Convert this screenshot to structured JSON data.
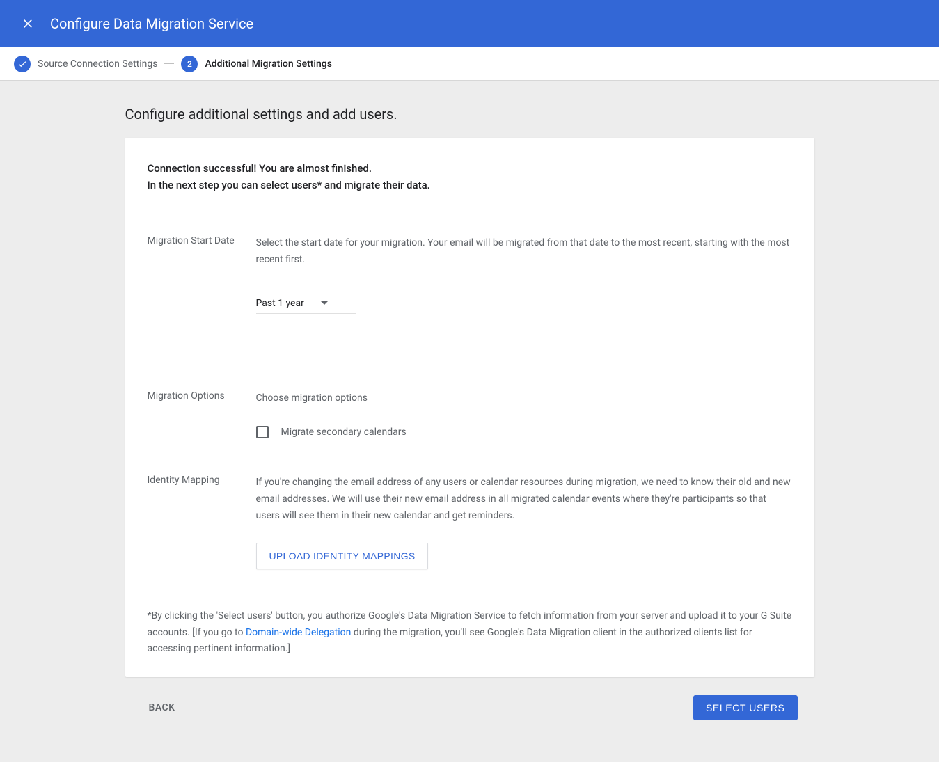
{
  "header": {
    "title": "Configure Data Migration Service"
  },
  "stepper": {
    "step1": {
      "label": "Source Connection Settings"
    },
    "step2": {
      "number": "2",
      "label": "Additional Migration Settings"
    }
  },
  "page": {
    "title": "Configure additional settings and add users."
  },
  "intro": {
    "line1": "Connection successful! You are almost finished.",
    "line2": "In the next step you can select users* and migrate their data."
  },
  "sections": {
    "startDate": {
      "label": "Migration Start Date",
      "desc": "Select the start date for your migration. Your email will be migrated from that date to the most recent, starting with the most recent first.",
      "selectValue": "Past 1 year"
    },
    "options": {
      "label": "Migration Options",
      "desc": "Choose migration options",
      "checkbox1": "Migrate secondary calendars"
    },
    "identity": {
      "label": "Identity Mapping",
      "desc": "If you're changing the email address of any users or calendar resources during migration, we need to know their old and new email addresses. We will use their new email address in all migrated calendar events where they're participants so that users will see them in their new calendar and get reminders.",
      "uploadBtn": "UPLOAD IDENTITY MAPPINGS"
    }
  },
  "disclaimer": {
    "pre": "*By clicking the 'Select users' button, you authorize Google's Data Migration Service to fetch information from your server and upload it to your G Suite accounts. [If you go to ",
    "link": "Domain-wide Delegation",
    "post": " during the migration, you'll see Google's Data Migration client in the authorized clients list for accessing pertinent information.]"
  },
  "footer": {
    "back": "BACK",
    "primary": "SELECT USERS"
  }
}
